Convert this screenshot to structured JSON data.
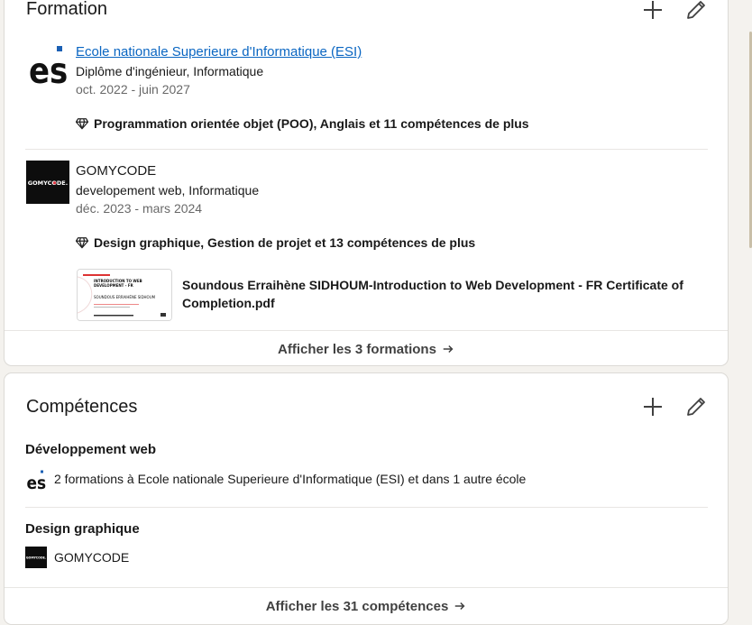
{
  "formation": {
    "title": "Formation",
    "entries": [
      {
        "school": "Ecole nationale Superieure d'Informatique (ESI)",
        "degree": "Diplôme d'ingénieur, Informatique",
        "dates": "oct. 2022 - juin 2027",
        "skills": "Programmation orientée objet (POO), Anglais et 11 compétences de plus",
        "logo_text": "esi"
      },
      {
        "school": "GOMYCODE",
        "degree": "developement web, Informatique",
        "dates": "déc. 2023 - mars 2024",
        "skills": "Design graphique, Gestion de projet et 13 compétences de plus",
        "logo_text": "GOMYCODE.",
        "document_title": "Soundous Erraihène SIDHOUM-Introduction to Web Development - FR Certificate of Completion.pdf",
        "thumb_heading": "INTRODUCTION TO WEB DEVELOPMENT - FR",
        "thumb_name": "SOUNDOUS ERRAIHÈNE SIDHOUM"
      }
    ],
    "show_all": "Afficher les 3 formations"
  },
  "skills": {
    "title": "Compétences",
    "items": [
      {
        "name": "Développement web",
        "source": "2 formations à Ecole nationale Superieure d'Informatique (ESI) et dans 1 autre école"
      },
      {
        "name": "Design graphique",
        "source": "GOMYCODE"
      }
    ],
    "show_all": "Afficher les 31 compétences"
  },
  "colors": {
    "link": "#0a66c2",
    "background": "#f4f2ee",
    "card": "#ffffff"
  },
  "icons": [
    "plus-icon",
    "pencil-icon",
    "skill-diamond-icon",
    "arrow-right-icon"
  ]
}
